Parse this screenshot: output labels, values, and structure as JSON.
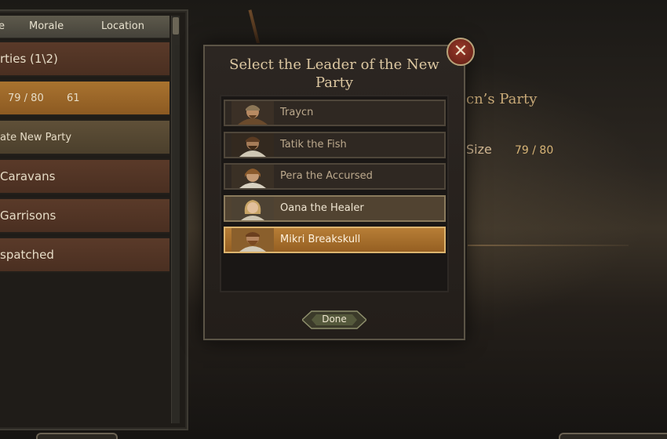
{
  "left_panel": {
    "headers": {
      "col1": "e",
      "col2": "Morale",
      "col3": "Location"
    },
    "rows": [
      {
        "label": "rties (1\\2)"
      },
      {
        "soldiers": "79 / 80",
        "morale": "61"
      },
      {
        "label": "ate New Party"
      },
      {
        "label": "Caravans"
      },
      {
        "label": "Garrisons"
      },
      {
        "label": "spatched"
      }
    ]
  },
  "background": {
    "party_title": "cn’s Party",
    "size_label": "Size",
    "size_value": "79 / 80"
  },
  "modal": {
    "title": "Select the Leader of the New Party",
    "close_glyph": "✕",
    "leaders": [
      {
        "name": "Traycn",
        "state": "normal"
      },
      {
        "name": "Tatik the Fish",
        "state": "normal"
      },
      {
        "name": "Pera the Accursed",
        "state": "normal"
      },
      {
        "name": "Oana the Healer",
        "state": "hover"
      },
      {
        "name": "Mikri Breakskull",
        "state": "selected"
      }
    ],
    "done_label": "Done"
  },
  "colors": {
    "accent_orange": "#a9732f",
    "panel_brown": "#5a3a29",
    "modal_bg": "#2c2622",
    "text_gold": "#dcc7a1"
  },
  "icons": [
    "close-icon",
    "portrait-icon"
  ]
}
